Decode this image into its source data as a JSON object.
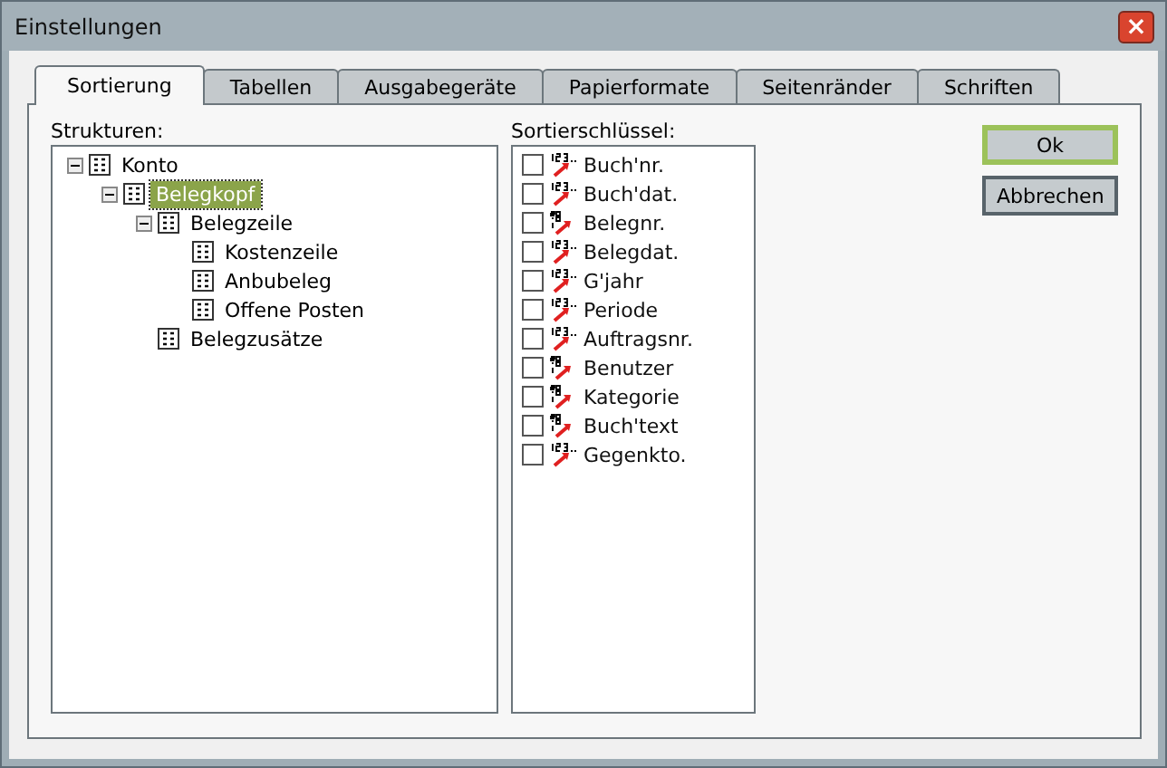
{
  "window": {
    "title": "Einstellungen",
    "close": "×"
  },
  "tabs": [
    {
      "label": "Sortierung",
      "selected": true
    },
    {
      "label": "Tabellen",
      "selected": false
    },
    {
      "label": "Ausgabegeräte",
      "selected": false
    },
    {
      "label": "Papierformate",
      "selected": false
    },
    {
      "label": "Seitenränder",
      "selected": false
    },
    {
      "label": "Schriften",
      "selected": false
    }
  ],
  "structures": {
    "label": "Strukturen:",
    "tree": [
      {
        "label": "Konto",
        "expanded": true,
        "selected": false,
        "children": [
          {
            "label": "Belegkopf",
            "expanded": true,
            "selected": true,
            "children": [
              {
                "label": "Belegzeile",
                "expanded": true,
                "selected": false,
                "children": [
                  {
                    "label": "Kostenzeile",
                    "selected": false
                  },
                  {
                    "label": "Anbubeleg",
                    "selected": false
                  },
                  {
                    "label": "Offene Posten",
                    "selected": false
                  }
                ]
              },
              {
                "label": "Belegzusätze",
                "selected": false
              }
            ]
          }
        ]
      }
    ]
  },
  "sort_keys": {
    "label": "Sortierschlüssel:",
    "items": [
      {
        "label": "Buch'nr.",
        "checked": false,
        "kind": "numeric"
      },
      {
        "label": "Buch'dat.",
        "checked": false,
        "kind": "numeric"
      },
      {
        "label": "Belegnr.",
        "checked": false,
        "kind": "text"
      },
      {
        "label": "Belegdat.",
        "checked": false,
        "kind": "numeric"
      },
      {
        "label": "G'jahr",
        "checked": false,
        "kind": "numeric"
      },
      {
        "label": "Periode",
        "checked": false,
        "kind": "numeric"
      },
      {
        "label": "Auftragsnr.",
        "checked": false,
        "kind": "numeric"
      },
      {
        "label": "Benutzer",
        "checked": false,
        "kind": "text"
      },
      {
        "label": "Kategorie",
        "checked": false,
        "kind": "text"
      },
      {
        "label": "Buch'text",
        "checked": false,
        "kind": "text"
      },
      {
        "label": "Gegenkto.",
        "checked": false,
        "kind": "numeric"
      }
    ]
  },
  "buttons": [
    {
      "label": "Ok",
      "default": true
    },
    {
      "label": "Abbrechen",
      "default": false
    }
  ]
}
